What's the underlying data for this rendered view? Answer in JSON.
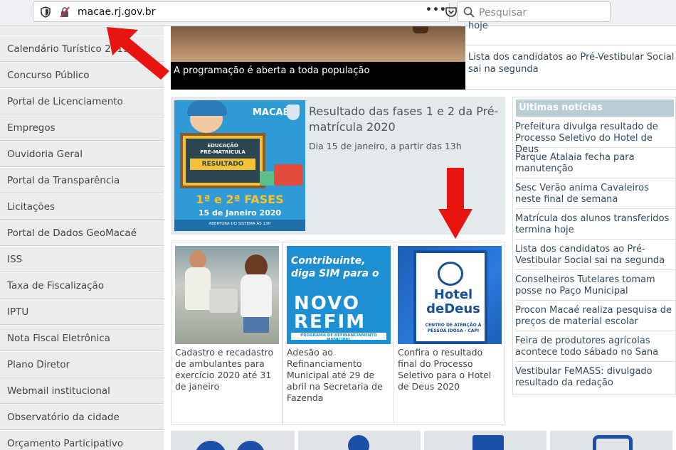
{
  "browser": {
    "url": "macae.rj.gov.br",
    "search_placeholder": "Pesquisar",
    "menu_dots": "•••"
  },
  "sidebar": {
    "items": [
      {
        "label": "Calendário Turístico 2019"
      },
      {
        "label": "Concurso Público"
      },
      {
        "label": "Portal de Licenciamento"
      },
      {
        "label": "Empregos"
      },
      {
        "label": "Ouvidoria Geral"
      },
      {
        "label": "Portal da Transparência"
      },
      {
        "label": "Licitações"
      },
      {
        "label": "Portal de Dados GeoMacaé"
      },
      {
        "label": "ISS"
      },
      {
        "label": "Taxa de Fiscalização"
      },
      {
        "label": "IPTU"
      },
      {
        "label": "Nota Fiscal Eletrônica"
      },
      {
        "label": "Plano Diretor"
      },
      {
        "label": "Webmail institucional"
      },
      {
        "label": "Observatório da cidade"
      },
      {
        "label": "Orçamento Participativo"
      }
    ]
  },
  "banner": {
    "caption": "A programação é aberta a toda população",
    "side_text_top": "hoje",
    "side_text": "Lista dos candidatos ao Pré-Vestibular Social sai na segunda"
  },
  "feature": {
    "title": "Resultado das fases 1 e 2 da Pré-matrícula 2020",
    "subtitle": "Dia 15 de janeiro, a partir das 13h",
    "poster": {
      "logo": "MACAÉ",
      "line1": "EDUCAÇÃO",
      "line2": "PRÉ-MATRÍCULA",
      "line3": "RESULTADO",
      "fases": "1ª e 2ª FASES",
      "date": "15 de Janeiro 2020",
      "strip": "ABERTURA DO SISTEMA ÀS 13H"
    }
  },
  "cards": [
    {
      "caption": "Cadastro e recadastro de ambulantes para exercício 2020 até 31 de janeiro"
    },
    {
      "caption": "Adesão ao Refinanciamento Municipal até 29 de abril na Secretaria de Fazenda",
      "img_text": "Contribuinte, diga SIM para o",
      "img_novo": "NOVO",
      "img_refim": "REFIM",
      "img_bar": "PROGRAMA DE REFINANCIAMENTO MUNICIPAL"
    },
    {
      "caption": "Confira o resultado final do Processo Seletivo para o Hotel de Deus 2020",
      "img_hotel": "Hotel",
      "img_dedeus": "deDeus",
      "img_sub": "CENTRO DE ATENÇÃO À PESSOA IDOSA - CAPI"
    }
  ],
  "news": {
    "header": "Últimas notícias",
    "items": [
      {
        "text": "Prefeitura divulga resultado de Processo Seletivo do Hotel de Deus"
      },
      {
        "text": "Parque Atalaia fecha para manutenção"
      },
      {
        "text": "Sesc Verão anima Cavaleiros neste final de semana"
      },
      {
        "text": "Matrícula dos alunos transferidos termina hoje"
      },
      {
        "text": "Lista dos candidatos ao Pré-Vestibular Social sai na segunda"
      },
      {
        "text": "Conselheiros Tutelares tomam posse no Paço Municipal"
      },
      {
        "text": "Procon Macaé realiza pesquisa de preços de material escolar"
      },
      {
        "text": "Feira de produtores agrícolas acontece todo sábado no Sana"
      },
      {
        "text": "Vestibular FeMASS: divulgado resultado da redação"
      }
    ]
  },
  "colors": {
    "accent_blue": "#1c4fa8",
    "news_header_bg": "#b9cdd4",
    "link_text": "#334a5e",
    "annotation_arrow": "#e8140f"
  }
}
